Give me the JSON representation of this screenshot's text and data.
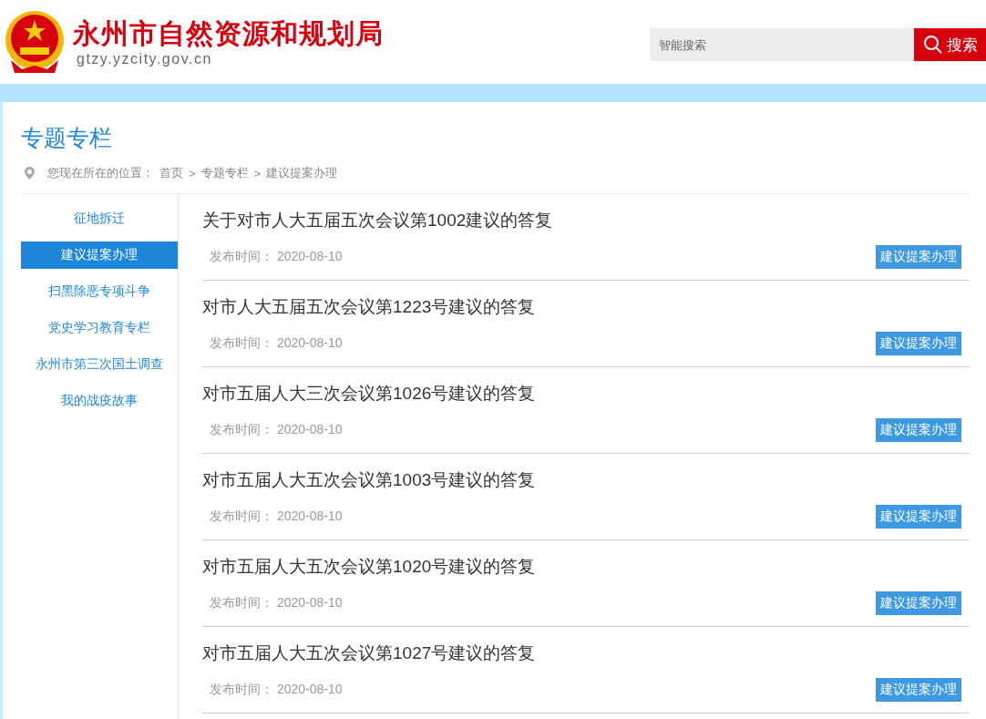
{
  "header": {
    "site_title": "永州市自然资源和规划局",
    "site_url": "gtzy.yzcity.gov.cn",
    "search": {
      "placeholder": "智能搜索",
      "button": "搜索"
    }
  },
  "section_title": "专题专栏",
  "breadcrumb": {
    "label": "您现在所在的位置：",
    "items": [
      "首页",
      "专题专栏",
      "建议提案办理"
    ],
    "separator": ">"
  },
  "sidebar": {
    "items": [
      {
        "label": "征地拆迁",
        "selected": false
      },
      {
        "label": "建议提案办理",
        "selected": true
      },
      {
        "label": "扫黑除恶专项斗争",
        "selected": false
      },
      {
        "label": "党史学习教育专栏",
        "selected": false
      },
      {
        "label": "永州市第三次国土调查",
        "selected": false
      },
      {
        "label": "我的战疫故事",
        "selected": false
      }
    ]
  },
  "articles": [
    {
      "title": "关于对市人大五届五次会议第1002建议的答复",
      "date_label": "发布时间：",
      "date": "2020-08-10",
      "tag": "建议提案办理"
    },
    {
      "title": "对市人大五届五次会议第1223号建议的答复",
      "date_label": "发布时间：",
      "date": "2020-08-10",
      "tag": "建议提案办理"
    },
    {
      "title": "对市五届人大三次会议第1026号建议的答复",
      "date_label": "发布时间：",
      "date": "2020-08-10",
      "tag": "建议提案办理"
    },
    {
      "title": "对市五届人大五次会议第1003号建议的答复",
      "date_label": "发布时间：",
      "date": "2020-08-10",
      "tag": "建议提案办理"
    },
    {
      "title": "对市五届人大五次会议第1020号建议的答复",
      "date_label": "发布时间：",
      "date": "2020-08-10",
      "tag": "建议提案办理"
    },
    {
      "title": "对市五届人大五次会议第1027号建议的答复",
      "date_label": "发布时间：",
      "date": "2020-08-10",
      "tag": "建议提案办理"
    }
  ]
}
